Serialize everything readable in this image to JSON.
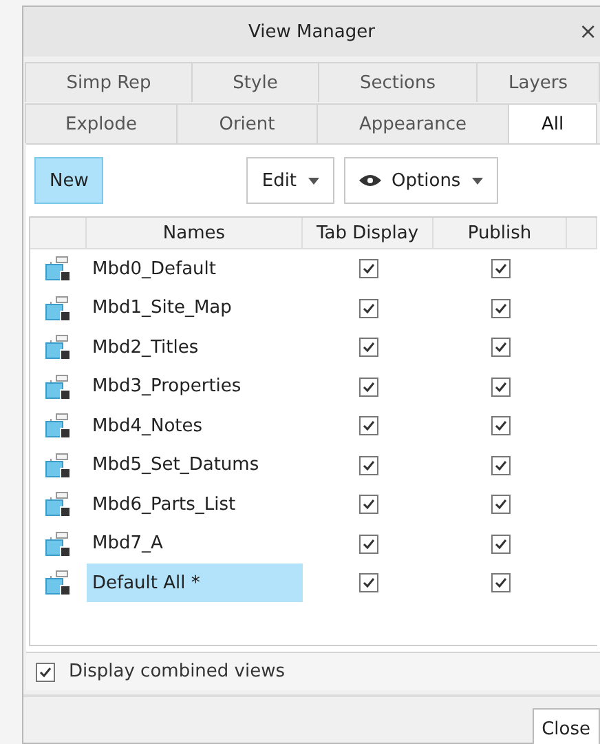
{
  "window": {
    "title": "View Manager",
    "close": "×"
  },
  "tab_rows": [
    [
      {
        "label": "Simp Rep",
        "selected": false
      },
      {
        "label": "Style",
        "selected": false
      },
      {
        "label": "Sections",
        "selected": false
      },
      {
        "label": "Layers",
        "selected": false
      }
    ],
    [
      {
        "label": "Explode",
        "selected": false
      },
      {
        "label": "Orient",
        "selected": false
      },
      {
        "label": "Appearance",
        "selected": false
      },
      {
        "label": "All",
        "selected": true
      }
    ]
  ],
  "toolbar": {
    "new": "New",
    "edit": "Edit",
    "options": "Options"
  },
  "table": {
    "columns": [
      "Names",
      "Tab Display",
      "Publish"
    ],
    "rows": [
      {
        "name": "Mbd0_Default",
        "tab_display": true,
        "publish": true,
        "selected": false
      },
      {
        "name": "Mbd1_Site_Map",
        "tab_display": true,
        "publish": true,
        "selected": false
      },
      {
        "name": "Mbd2_Titles",
        "tab_display": true,
        "publish": true,
        "selected": false
      },
      {
        "name": "Mbd3_Properties",
        "tab_display": true,
        "publish": true,
        "selected": false
      },
      {
        "name": "Mbd4_Notes",
        "tab_display": true,
        "publish": true,
        "selected": false
      },
      {
        "name": "Mbd5_Set_Datums",
        "tab_display": true,
        "publish": true,
        "selected": false
      },
      {
        "name": "Mbd6_Parts_List",
        "tab_display": true,
        "publish": true,
        "selected": false
      },
      {
        "name": "Mbd7_A",
        "tab_display": true,
        "publish": true,
        "selected": false
      },
      {
        "name": "Default All *",
        "tab_display": true,
        "publish": true,
        "selected": true
      }
    ]
  },
  "display_combined": {
    "label": "Display combined views",
    "checked": true
  },
  "buttons": {
    "close": "Close"
  }
}
